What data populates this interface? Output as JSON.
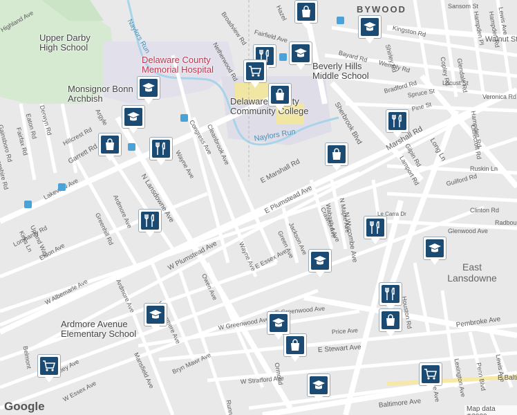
{
  "map": {
    "neighborhoods": [
      "BYWOOD",
      "East Lansdowne"
    ],
    "pois": {
      "upper_darby_hs": "Upper Darby\nHigh School",
      "delaware_county_hospital": "Delaware County\nMemorial Hospital",
      "monsignor": "Monsignor Bonn\nArchbish",
      "beverly_hills": "Beverly Hills\nMiddle School",
      "delaware_cc": "Delaware County\nCommunity College",
      "ardmore": "Ardmore Avenue\nElementary School"
    },
    "streets": [
      "Highland Ave",
      "Broadview Rd",
      "Fairfield Ave",
      "Netherwood Rd",
      "Hazel",
      "Sansom St",
      "Kingston Rd",
      "Bayard Rd",
      "Wembly Rd",
      "Walnut St",
      "Locust St",
      "Spruce St",
      "Bradford Rd",
      "Pine St",
      "Veronica Rd",
      "Copley Rd",
      "Glendale Rd",
      "Hampden Rd",
      "Littlecroft Rd",
      "Sherbrook Blvd",
      "Marshall Rd",
      "E Marshall Rd",
      "N Lansdowne Ave",
      "Garrett Rd",
      "Long Ln",
      "Ruskin Ln",
      "Guilford Rd",
      "Clinton Rd",
      "Glenwood Ave",
      "Radbourne",
      "E Plumstead Ave",
      "W Plumstead Ave",
      "Pembroke Ave",
      "E Stewart Ave",
      "Price Ave",
      "W Greenwood Ave",
      "E Greenwood Ave",
      "W Albemarle Ave",
      "Ardmore Ave",
      "Windermere Ave",
      "Owen Ave",
      "Wayne Ave",
      "Congress Ave",
      "Cleanbrook Ave",
      "Argyle",
      "Derwyn Rd",
      "Eaton Rd",
      "Fairfax Rd",
      "Gainsboro Rd",
      "Hampshire Rd",
      "Hillcrest Rd",
      "Lakeview Ave",
      "Upland Way",
      "Kirks Ln",
      "Lombardy Rd",
      "Eldon Ave",
      "Greenhill Rd",
      "Green Ave",
      "Jackson Ave",
      "Crawford Ave",
      "Wabash Ave",
      "N Maple Ave",
      "N Wycombe Ave",
      "Le Carra Dr",
      "Houston Rd",
      "Lexington Ave",
      "Melrose Ave",
      "Penn Blvd",
      "Lewis Ave",
      "E Baltimore Ave",
      "Baltimore Ave",
      "W Stratford Ave",
      "Bryn Mawr Ave",
      "Berkley Ave",
      "W Essex Ave",
      "E Essex Ave",
      "Mansfield Ave",
      "Runnemede",
      "Belmont",
      "Naylors Run",
      "Naylors Run",
      "Gilpin Rd",
      "Lamport Rd",
      "Shirley Rd",
      "Hampden Pl",
      "Hampden Rd",
      "Lewis Ave",
      "Ormond",
      "Wayne Ave",
      "Ardmore Ave"
    ],
    "markers": [
      "shopping-bag",
      "graduation-cap",
      "shopping-cart",
      "restaurant",
      "shopping-bag",
      "graduation-cap",
      "graduation-cap",
      "graduation-cap",
      "restaurant",
      "shopping-bag",
      "restaurant",
      "restaurant",
      "graduation-cap",
      "graduation-cap",
      "restaurant",
      "shopping-bag",
      "graduation-cap",
      "shopping-bag",
      "shopping-cart",
      "shopping-cart",
      "graduation-cap",
      "shopping-bag",
      "graduation-cap",
      "restaurant"
    ],
    "attribution": "Map data ©2020",
    "logo": "Google"
  }
}
